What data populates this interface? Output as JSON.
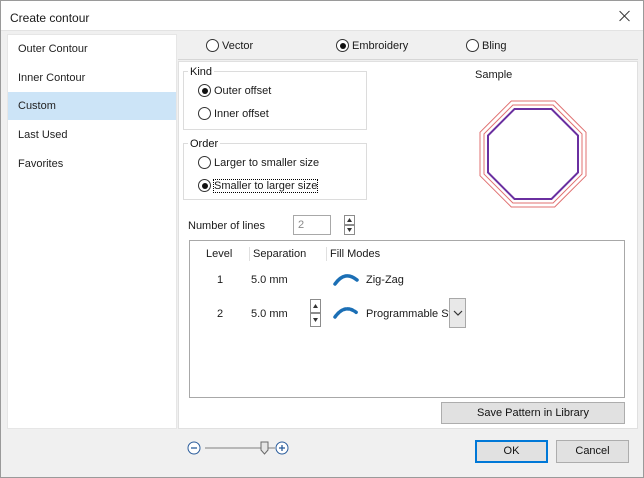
{
  "window": {
    "title": "Create contour"
  },
  "sidebar": {
    "items": [
      {
        "label": "Outer Contour",
        "selected": false
      },
      {
        "label": "Inner Contour",
        "selected": false
      },
      {
        "label": "Custom",
        "selected": true
      },
      {
        "label": "Last Used",
        "selected": false
      },
      {
        "label": "Favorites",
        "selected": false
      }
    ]
  },
  "type_options": [
    {
      "label": "Vector",
      "checked": false
    },
    {
      "label": "Embroidery",
      "checked": true
    },
    {
      "label": "Bling",
      "checked": false
    }
  ],
  "kind": {
    "label": "Kind",
    "options": [
      {
        "label": "Outer offset",
        "checked": true
      },
      {
        "label": "Inner offset",
        "checked": false
      }
    ]
  },
  "order": {
    "label": "Order",
    "options": [
      {
        "label": "Larger to smaller size",
        "checked": false
      },
      {
        "label": "Smaller to larger size",
        "checked": true
      }
    ]
  },
  "sample": {
    "label": "Sample"
  },
  "lines": {
    "label": "Number of lines",
    "value": "2"
  },
  "table": {
    "headers": {
      "level": "Level",
      "separation": "Separation",
      "fill_modes": "Fill Modes"
    },
    "rows": [
      {
        "level": "1",
        "separation": "5.0 mm",
        "fill_mode": "Zig-Zag"
      },
      {
        "level": "2",
        "separation": "5.0 mm",
        "fill_mode": "Programmable Sti"
      }
    ]
  },
  "buttons": {
    "save_pattern": "Save Pattern in Library",
    "ok": "OK",
    "cancel": "Cancel"
  },
  "zoom": {
    "level": 0.85
  },
  "icons": {
    "close": "close-icon",
    "zoom_out": "zoom-out-icon",
    "zoom_in": "zoom-in-icon",
    "zigzag": "zigzag-stitch-icon",
    "programmable": "programmable-stitch-icon",
    "dropdown": "chevron-down-icon"
  },
  "colors": {
    "selection": "#cce4f7",
    "accent": "#0078d7",
    "sample_outer": "#e07070",
    "sample_inner": "#6a2fa0",
    "stitch_icon": "#1b6fb5"
  }
}
